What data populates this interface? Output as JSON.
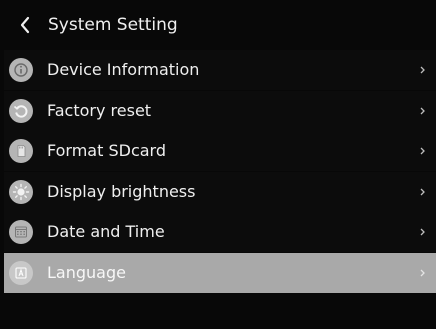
{
  "header": {
    "back_icon": "chevron-left-icon",
    "title": "System Setting"
  },
  "menu": {
    "items": [
      {
        "label": "Device Information",
        "icon": "info-icon",
        "selected": false
      },
      {
        "label": "Factory reset",
        "icon": "reset-icon",
        "selected": false
      },
      {
        "label": "Format SDcard",
        "icon": "sdcard-icon",
        "selected": false
      },
      {
        "label": "Display brightness",
        "icon": "brightness-icon",
        "selected": false
      },
      {
        "label": "Date and Time",
        "icon": "calendar-icon",
        "selected": false
      },
      {
        "label": "Language",
        "icon": "language-icon",
        "selected": true
      }
    ]
  },
  "colors": {
    "background": "#080808",
    "selected_row": "#a9a9a9",
    "icon_circle": "#b5b5b5",
    "text": "#efefef"
  }
}
